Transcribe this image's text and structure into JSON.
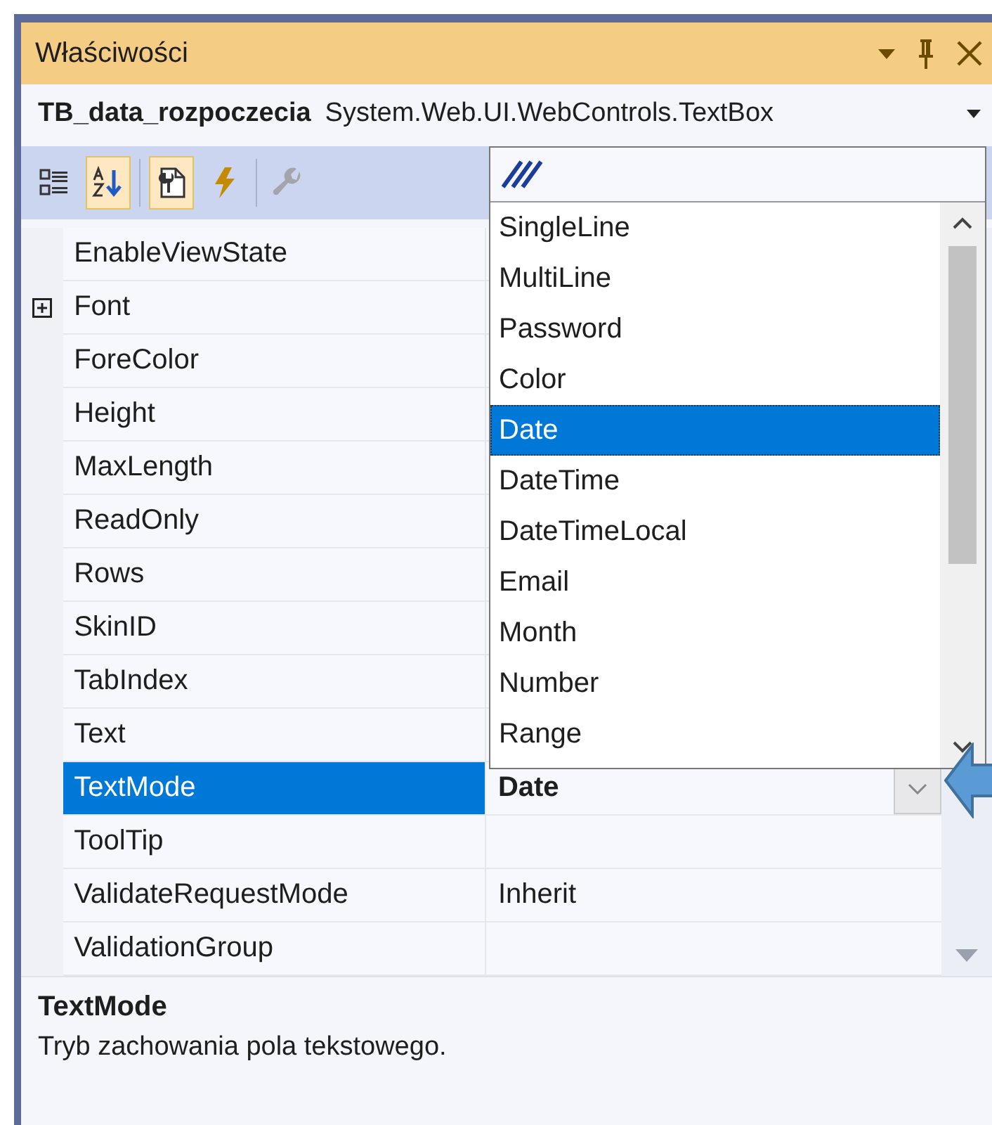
{
  "window": {
    "title": "Właściwości"
  },
  "object_selector": {
    "name": "TB_data_rozpoczecia",
    "type": "System.Web.UI.WebControls.TextBox"
  },
  "toolbar": [
    {
      "kind": "categorized",
      "selected": false,
      "disabled": false
    },
    {
      "kind": "alphabetical",
      "selected": true,
      "disabled": false
    },
    {
      "kind": "properties",
      "selected": true,
      "disabled": false
    },
    {
      "kind": "events",
      "selected": false,
      "disabled": false
    },
    {
      "kind": "property_pages",
      "selected": false,
      "disabled": true
    }
  ],
  "properties": [
    {
      "kind": "property",
      "name": "EnableViewState",
      "selected": false
    },
    {
      "kind": "group",
      "name": "Font",
      "selected": false
    },
    {
      "kind": "property",
      "name": "ForeColor",
      "selected": false
    },
    {
      "kind": "property",
      "name": "Height",
      "selected": false
    },
    {
      "kind": "property",
      "name": "MaxLength",
      "selected": false
    },
    {
      "kind": "property",
      "name": "ReadOnly",
      "selected": false
    },
    {
      "kind": "property",
      "name": "Rows",
      "selected": false
    },
    {
      "kind": "property",
      "name": "SkinID",
      "selected": false
    },
    {
      "kind": "property",
      "name": "TabIndex",
      "selected": false
    },
    {
      "kind": "property",
      "name": "Text",
      "selected": false
    },
    {
      "kind": "property",
      "name": "TextMode",
      "selected": true,
      "value": "Date",
      "modified": true
    },
    {
      "kind": "property",
      "name": "ToolTip",
      "selected": false
    },
    {
      "kind": "property",
      "name": "ValidateRequestMode",
      "selected": false,
      "value": "Inherit",
      "modified": false
    },
    {
      "kind": "property",
      "name": "ValidationGroup",
      "selected": false
    }
  ],
  "dropdown": {
    "options": [
      {
        "label": "SingleLine",
        "selected": false
      },
      {
        "label": "MultiLine",
        "selected": false
      },
      {
        "label": "Password",
        "selected": false
      },
      {
        "label": "Color",
        "selected": false
      },
      {
        "label": "Date",
        "selected": true
      },
      {
        "label": "DateTime",
        "selected": false
      },
      {
        "label": "DateTimeLocal",
        "selected": false
      },
      {
        "label": "Email",
        "selected": false
      },
      {
        "label": "Month",
        "selected": false
      },
      {
        "label": "Number",
        "selected": false
      },
      {
        "label": "Range",
        "selected": false
      }
    ]
  },
  "description": {
    "title": "TextMode",
    "text": "Tryb zachowania pola tekstowego."
  }
}
